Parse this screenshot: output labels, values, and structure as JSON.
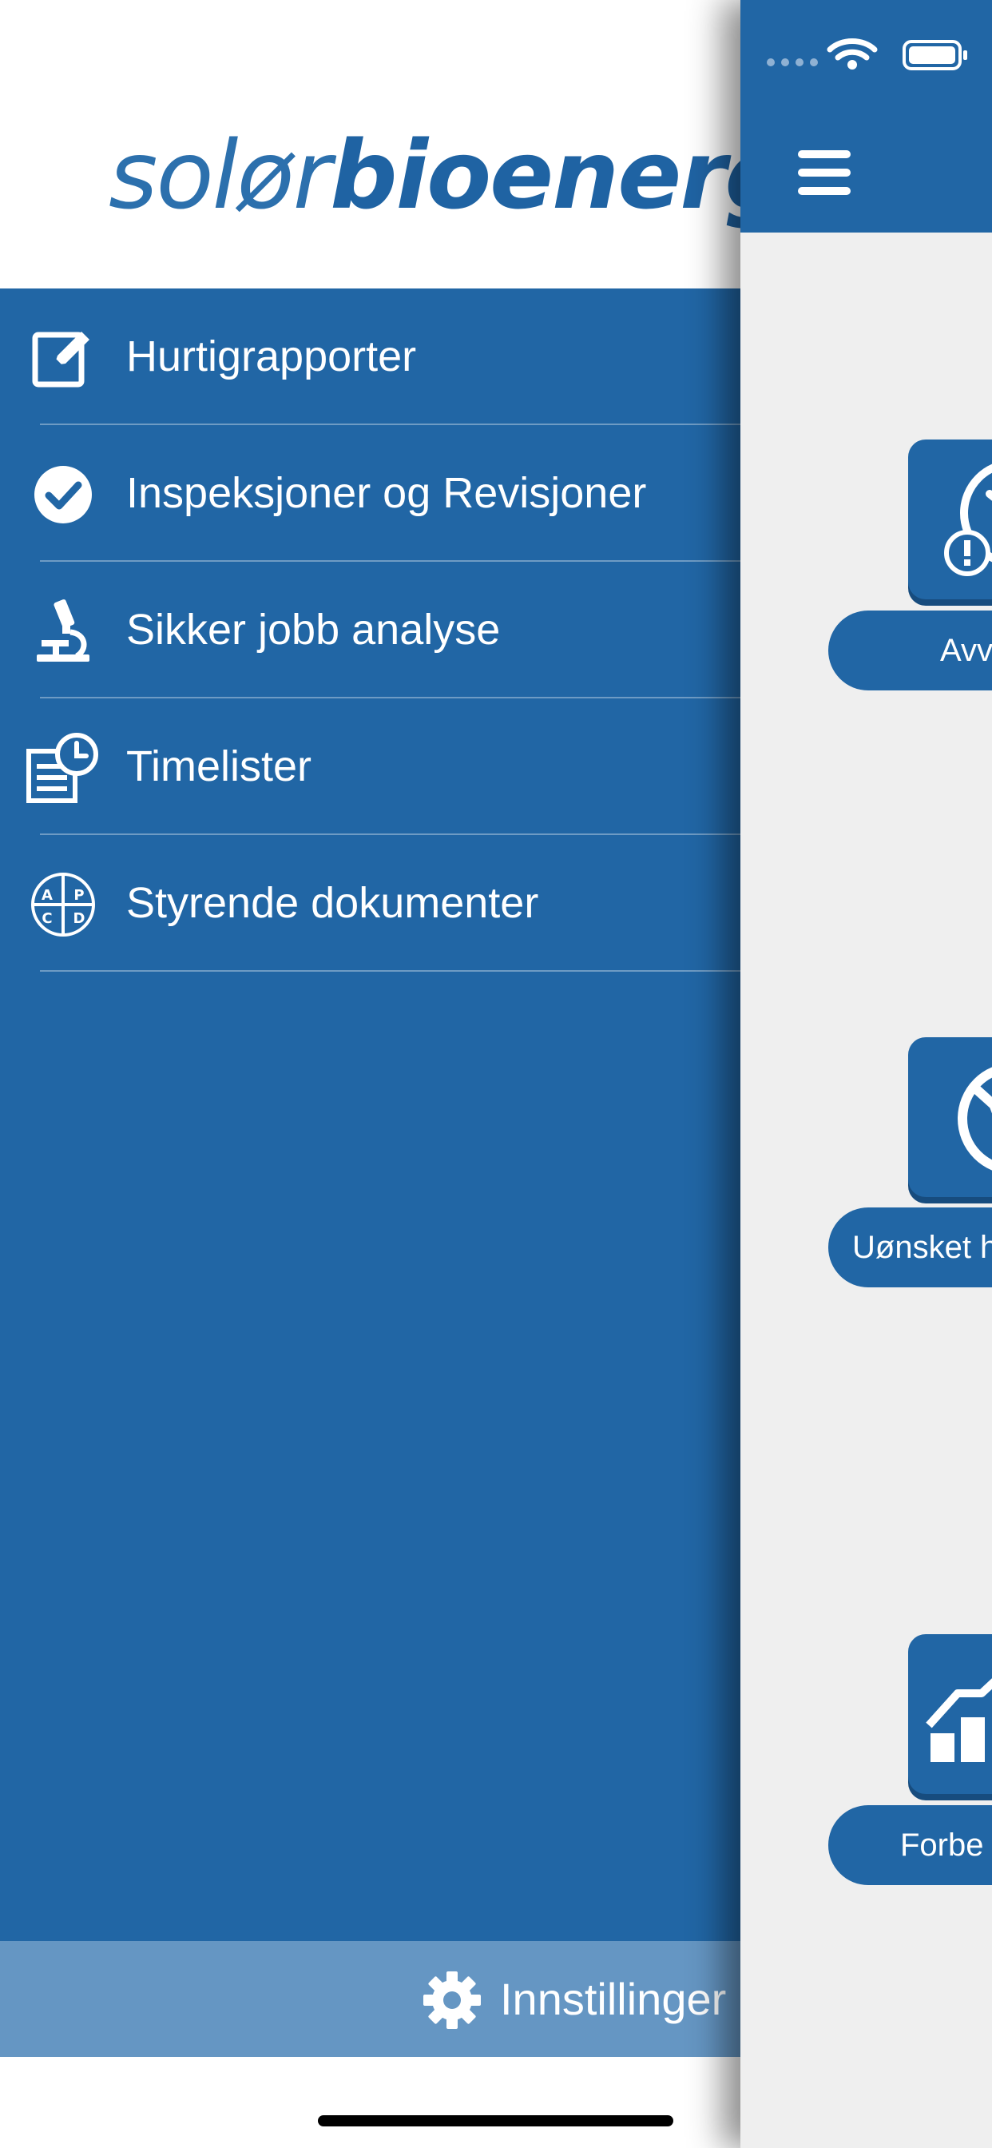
{
  "app": {
    "logo": {
      "light": "solør",
      "bold": "bioenergi"
    }
  },
  "menu": {
    "items": [
      {
        "label": "Hurtigrapporter",
        "icon": "edit-note-icon"
      },
      {
        "label": "Inspeksjoner og Revisjoner",
        "icon": "check-circle-icon"
      },
      {
        "label": "Sikker jobb analyse",
        "icon": "microscope-icon"
      },
      {
        "label": "Timelister",
        "icon": "timesheet-clock-icon"
      },
      {
        "label": "Styrende dokumenter",
        "icon": "pdca-icon"
      }
    ],
    "pdca_letters": [
      "A",
      "P",
      "C",
      "D"
    ]
  },
  "settings": {
    "label": "Innstillinger",
    "icon": "gear-icon"
  },
  "main": {
    "tiles": [
      {
        "label": "Avv",
        "icon": "clock-warning-icon"
      },
      {
        "label": "Uønsket h",
        "icon": "no-hand-icon"
      },
      {
        "label": "Forbe",
        "icon": "improvement-chart-icon"
      }
    ]
  },
  "colors": {
    "brand_blue": "#2166a5",
    "settings_bar": "#6596c3",
    "content_bg": "#efefef"
  }
}
